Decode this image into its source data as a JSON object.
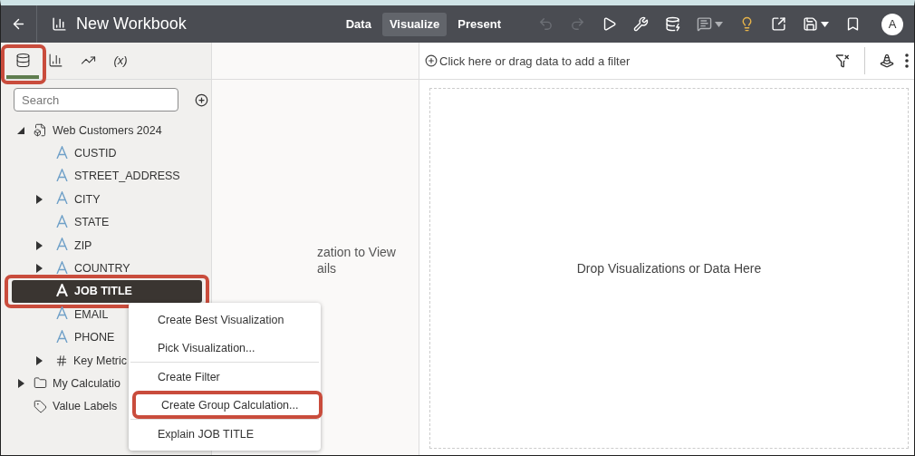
{
  "header": {
    "title": "New Workbook",
    "nav": [
      {
        "label": "Data",
        "selected": false
      },
      {
        "label": "Visualize",
        "selected": true
      },
      {
        "label": "Present",
        "selected": false
      }
    ],
    "tools": [
      {
        "kind": "undo",
        "disabled": true
      },
      {
        "kind": "redo",
        "disabled": true
      },
      {
        "kind": "play",
        "disabled": false
      },
      {
        "kind": "tools",
        "disabled": false
      },
      {
        "kind": "database",
        "disabled": false
      },
      {
        "kind": "comment",
        "disabled": true
      },
      {
        "kind": "bulb",
        "disabled": false
      },
      {
        "kind": "export",
        "disabled": false
      },
      {
        "kind": "save",
        "disabled": false
      },
      {
        "kind": "bookmark",
        "disabled": false
      }
    ],
    "avatar": "A"
  },
  "panel_tabs": [
    {
      "kind": "data",
      "selected": true,
      "annotated": true
    },
    {
      "kind": "chart",
      "selected": false
    },
    {
      "kind": "analytics",
      "selected": false
    },
    {
      "kind": "variables",
      "label": "(x)",
      "selected": false
    }
  ],
  "search": {
    "placeholder": "Search"
  },
  "tree": [
    {
      "label": "Web Customers 2024",
      "kind": "dataset",
      "expanded": true,
      "children": [
        {
          "label": "CUSTID",
          "kind": "attribute",
          "expandable": false,
          "selected": false,
          "annotated": false
        },
        {
          "label": "STREET_ADDRESS",
          "kind": "attribute",
          "expandable": false,
          "selected": false,
          "annotated": false
        },
        {
          "label": "CITY",
          "kind": "attribute",
          "expandable": true,
          "selected": false,
          "annotated": false
        },
        {
          "label": "STATE",
          "kind": "attribute",
          "expandable": false,
          "selected": false,
          "annotated": false
        },
        {
          "label": "ZIP",
          "kind": "attribute",
          "expandable": true,
          "selected": false,
          "annotated": false
        },
        {
          "label": "COUNTRY",
          "kind": "attribute",
          "expandable": true,
          "selected": false,
          "annotated": false
        },
        {
          "label": "JOB TITLE",
          "kind": "attribute",
          "expandable": false,
          "selected": true,
          "annotated": true
        },
        {
          "label": "EMAIL",
          "kind": "attribute",
          "expandable": false,
          "selected": false,
          "annotated": false
        },
        {
          "label": "PHONE",
          "kind": "attribute",
          "expandable": false,
          "selected": false,
          "annotated": false
        },
        {
          "label": "Key Metric",
          "kind": "metrics",
          "expandable": true,
          "selected": false,
          "annotated": false
        }
      ]
    },
    {
      "label": "My Calculatio",
      "kind": "folder",
      "expanded": false
    },
    {
      "label": "Value Labels",
      "kind": "tag"
    }
  ],
  "middle_hint": [
    "zation to View",
    "ails"
  ],
  "filter_bar": {
    "placeholder": "Click here or drag data to add a filter"
  },
  "canvas": {
    "hint": "Drop Visualizations or Data Here"
  },
  "context_menu": {
    "groups": [
      [
        {
          "label": "Create Best Visualization",
          "annotated": false
        },
        {
          "label": "Pick Visualization...",
          "annotated": false
        }
      ],
      [
        {
          "label": "Create Filter",
          "annotated": false
        },
        {
          "label": "Create Group Calculation...",
          "annotated": true
        }
      ],
      [
        {
          "label": "Explain JOB TITLE",
          "annotated": false
        }
      ]
    ]
  }
}
